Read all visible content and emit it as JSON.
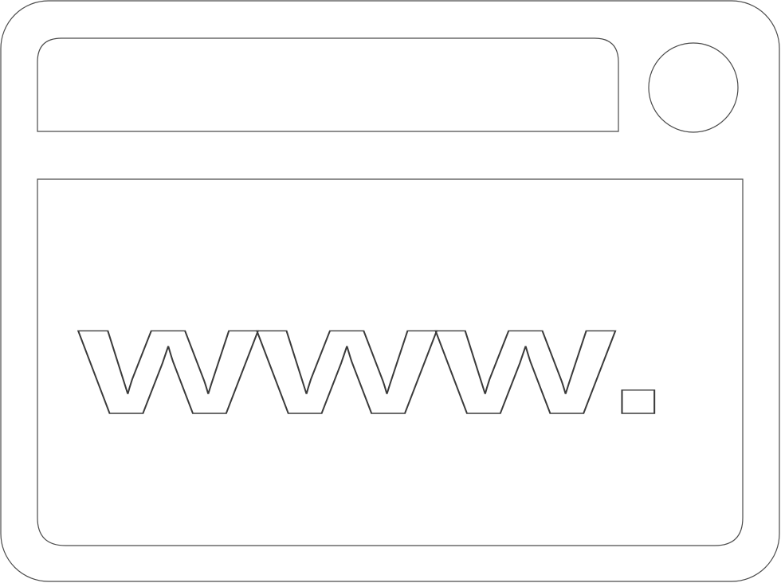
{
  "icon": {
    "name": "browser-window-icon",
    "label_text": "www.",
    "stroke_color": "#4a4a4a",
    "fill_color": "#ffffff"
  }
}
